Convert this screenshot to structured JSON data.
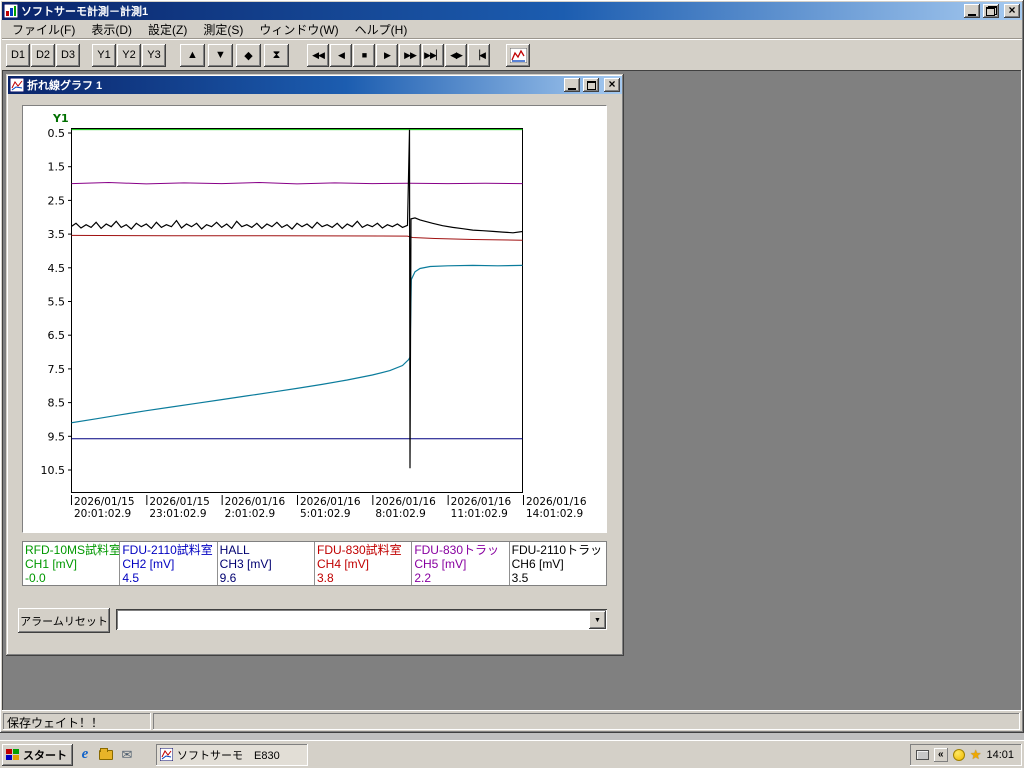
{
  "window": {
    "title": "ソフトサーモ計測－計測1"
  },
  "menu": {
    "items": [
      "ファイル(F)",
      "表示(D)",
      "設定(Z)",
      "測定(S)",
      "ウィンドウ(W)",
      "ヘルプ(H)"
    ]
  },
  "toolbar": {
    "d_buttons": [
      "D1",
      "D2",
      "D3"
    ],
    "y_buttons": [
      "Y1",
      "Y2",
      "Y3"
    ],
    "nav_buttons": [
      {
        "name": "scroll-up",
        "glyph": "▲"
      },
      {
        "name": "scroll-down",
        "glyph": "▼"
      },
      {
        "name": "zoom-vertical",
        "glyph": "◆"
      },
      {
        "name": "time-compress",
        "glyph": "⧗"
      }
    ],
    "transport_buttons": [
      {
        "name": "fast-rewind",
        "glyph": "◀◀"
      },
      {
        "name": "step-back",
        "glyph": "◀"
      },
      {
        "name": "stop",
        "glyph": "■"
      },
      {
        "name": "step-forward",
        "glyph": "▶"
      },
      {
        "name": "fast-forward",
        "glyph": "▶▶"
      },
      {
        "name": "go-to-latest",
        "glyph": "▶▶▏"
      },
      {
        "name": "expand-range",
        "glyph": "◀▶"
      },
      {
        "name": "go-to-start",
        "glyph": "▕◀"
      }
    ]
  },
  "graph_window": {
    "title": "折れ線グラフ 1"
  },
  "chart_data": {
    "type": "line",
    "title": "折れ線グラフ 1",
    "axis_label": "Y1",
    "axis_color": "#007000",
    "y_inverted": true,
    "y_range": [
      0.5,
      10.5
    ],
    "y_ticks": [
      0.5,
      1.5,
      2.5,
      3.5,
      4.5,
      5.5,
      6.5,
      7.5,
      8.5,
      9.5,
      10.5
    ],
    "x_unit": "hours",
    "x_range_hours": [
      0,
      18
    ],
    "x_ticks": [
      {
        "date": "2026/01/15",
        "time": "20:01:02.9"
      },
      {
        "date": "2026/01/15",
        "time": "23:01:02.9"
      },
      {
        "date": "2026/01/16",
        "time": "2:01:02.9"
      },
      {
        "date": "2026/01/16",
        "time": "5:01:02.9"
      },
      {
        "date": "2026/01/16",
        "time": "8:01:02.9"
      },
      {
        "date": "2026/01/16",
        "time": "11:01:02.9"
      },
      {
        "date": "2026/01/16",
        "time": "14:01:02.9"
      }
    ],
    "series": [
      {
        "name": "CH1",
        "color": "#00c000",
        "width": 1,
        "points": [
          [
            0,
            0.4
          ],
          [
            18,
            0.4
          ]
        ]
      },
      {
        "name": "CH3",
        "color": "#000080",
        "width": 1,
        "points": [
          [
            0,
            9.57
          ],
          [
            18,
            9.57
          ]
        ]
      },
      {
        "name": "CH4",
        "color": "#a01010",
        "width": 1,
        "points": [
          [
            0,
            3.54
          ],
          [
            4,
            3.55
          ],
          [
            8,
            3.55
          ],
          [
            13.4,
            3.56
          ],
          [
            13.6,
            3.6
          ],
          [
            14.5,
            3.63
          ],
          [
            16,
            3.66
          ],
          [
            18,
            3.68
          ]
        ]
      },
      {
        "name": "CH5",
        "color": "#880088",
        "width": 1,
        "points": [
          [
            0,
            2.0
          ],
          [
            1.5,
            1.97
          ],
          [
            3,
            2.01
          ],
          [
            4.5,
            1.98
          ],
          [
            6,
            2.0
          ],
          [
            7.5,
            1.97
          ],
          [
            9,
            2.01
          ],
          [
            10.5,
            1.98
          ],
          [
            12,
            2.0
          ],
          [
            13.5,
            1.99
          ],
          [
            15,
            2.0
          ],
          [
            16.5,
            1.99
          ],
          [
            18,
            2.0
          ]
        ]
      },
      {
        "name": "CH2",
        "color": "#0b7c9c",
        "width": 1.2,
        "points": [
          [
            0,
            9.1
          ],
          [
            1,
            8.98
          ],
          [
            2,
            8.86
          ],
          [
            3,
            8.74
          ],
          [
            4,
            8.63
          ],
          [
            5,
            8.52
          ],
          [
            6,
            8.41
          ],
          [
            7,
            8.3
          ],
          [
            8,
            8.19
          ],
          [
            9,
            8.08
          ],
          [
            10,
            7.96
          ],
          [
            11,
            7.83
          ],
          [
            12,
            7.68
          ],
          [
            12.7,
            7.55
          ],
          [
            13.2,
            7.4
          ],
          [
            13.45,
            7.22
          ],
          [
            13.5,
            7.15
          ],
          [
            13.55,
            4.85
          ],
          [
            13.7,
            4.62
          ],
          [
            13.9,
            4.52
          ],
          [
            14.3,
            4.46
          ],
          [
            15,
            4.44
          ],
          [
            16,
            4.43
          ],
          [
            17,
            4.44
          ],
          [
            18,
            4.43
          ]
        ]
      },
      {
        "name": "CH6",
        "color": "#000000",
        "width": 1.2,
        "points": [
          [
            0,
            3.28
          ],
          [
            0.2,
            3.18
          ],
          [
            0.4,
            3.32
          ],
          [
            0.6,
            3.22
          ],
          [
            0.8,
            3.3
          ],
          [
            1,
            3.15
          ],
          [
            1.2,
            3.33
          ],
          [
            1.4,
            3.2
          ],
          [
            1.6,
            3.28
          ],
          [
            1.8,
            3.12
          ],
          [
            2,
            3.3
          ],
          [
            2.2,
            3.22
          ],
          [
            2.4,
            3.35
          ],
          [
            2.6,
            3.18
          ],
          [
            2.8,
            3.28
          ],
          [
            3,
            3.2
          ],
          [
            3.2,
            3.33
          ],
          [
            3.4,
            3.15
          ],
          [
            3.6,
            3.3
          ],
          [
            3.8,
            3.22
          ],
          [
            4,
            3.28
          ],
          [
            4.2,
            3.1
          ],
          [
            4.4,
            3.32
          ],
          [
            4.6,
            3.2
          ],
          [
            4.8,
            3.28
          ],
          [
            5,
            3.18
          ],
          [
            5.2,
            3.35
          ],
          [
            5.4,
            3.22
          ],
          [
            5.6,
            3.28
          ],
          [
            5.8,
            3.15
          ],
          [
            6,
            3.3
          ],
          [
            6.2,
            3.2
          ],
          [
            6.4,
            3.33
          ],
          [
            6.6,
            3.12
          ],
          [
            6.8,
            3.28
          ],
          [
            7,
            3.22
          ],
          [
            7.2,
            3.3
          ],
          [
            7.4,
            3.18
          ],
          [
            7.6,
            3.33
          ],
          [
            7.8,
            3.2
          ],
          [
            8,
            3.28
          ],
          [
            8.2,
            3.15
          ],
          [
            8.4,
            3.3
          ],
          [
            8.6,
            3.22
          ],
          [
            8.8,
            3.35
          ],
          [
            9,
            3.18
          ],
          [
            9.2,
            3.28
          ],
          [
            9.4,
            3.2
          ],
          [
            9.6,
            3.32
          ],
          [
            9.8,
            3.15
          ],
          [
            10,
            3.28
          ],
          [
            10.2,
            3.22
          ],
          [
            10.4,
            3.3
          ],
          [
            10.6,
            3.18
          ],
          [
            10.8,
            3.33
          ],
          [
            11,
            3.2
          ],
          [
            11.2,
            3.28
          ],
          [
            11.4,
            3.12
          ],
          [
            11.6,
            3.3
          ],
          [
            11.8,
            3.22
          ],
          [
            12,
            3.28
          ],
          [
            12.2,
            3.18
          ],
          [
            12.4,
            3.32
          ],
          [
            12.6,
            3.22
          ],
          [
            12.8,
            3.28
          ],
          [
            13,
            3.2
          ],
          [
            13.2,
            3.3
          ],
          [
            13.4,
            3.24
          ],
          [
            13.48,
            0.4
          ],
          [
            13.5,
            10.45
          ],
          [
            13.54,
            3.05
          ],
          [
            13.7,
            3.02
          ],
          [
            13.9,
            3.08
          ],
          [
            14.1,
            3.12
          ],
          [
            14.4,
            3.18
          ],
          [
            14.8,
            3.25
          ],
          [
            15.2,
            3.3
          ],
          [
            15.6,
            3.34
          ],
          [
            16,
            3.38
          ],
          [
            16.4,
            3.4
          ],
          [
            16.8,
            3.42
          ],
          [
            17.2,
            3.44
          ],
          [
            17.6,
            3.46
          ],
          [
            18,
            3.42
          ]
        ]
      }
    ]
  },
  "legend": {
    "channels": [
      {
        "name": "RFD-10MS試料室",
        "channel": "CH1 [mV]",
        "value": "-0.0",
        "color": "#009800"
      },
      {
        "name": "FDU-2110試料室",
        "channel": "CH2 [mV]",
        "value": "4.5",
        "color": "#0000c0"
      },
      {
        "name": "HALL",
        "channel": "CH3 [mV]",
        "value": "9.6",
        "color": "#000070"
      },
      {
        "name": "FDU-830試料室",
        "channel": "CH4 [mV]",
        "value": "3.8",
        "color": "#c00000"
      },
      {
        "name": "FDU-830トラッ",
        "channel": "CH5 [mV]",
        "value": "2.2",
        "color": "#8800a0"
      },
      {
        "name": "FDU-2110トラッ",
        "channel": "CH6 [mV]",
        "value": "3.5",
        "color": "#000000"
      }
    ]
  },
  "alarm": {
    "reset_label": "アラームリセット",
    "combo_value": ""
  },
  "status_bar": {
    "text": "保存ウェイト！！"
  },
  "taskbar": {
    "start_label": "スタート",
    "task_label": "ソフトサーモ　E830",
    "chevron": "«",
    "clock": "14:01"
  }
}
